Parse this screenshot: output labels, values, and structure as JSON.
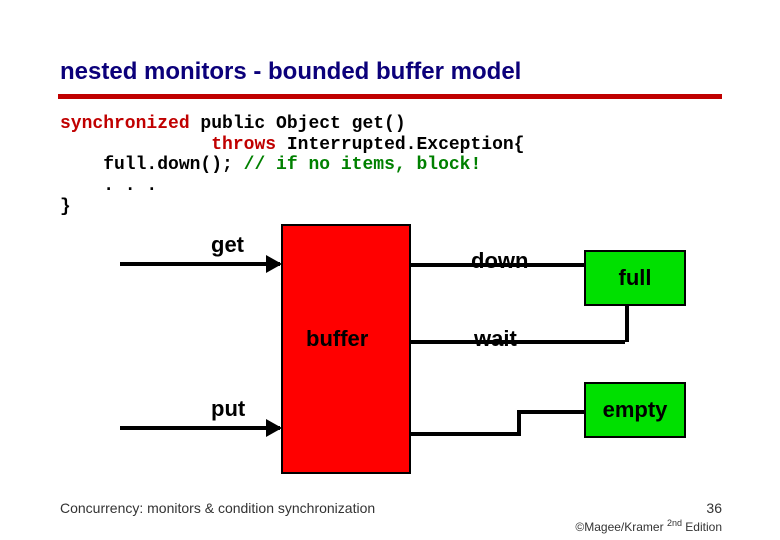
{
  "title": "nested monitors -  bounded buffer model",
  "code": {
    "kw_synchronized": "synchronized",
    "sig_part1": " public Object get()",
    "kw_throws": "throws",
    "sig_part2": " Interrupted.Exception{",
    "line3_a": "    full.down(); ",
    "cm_block": "// if no items, block!",
    "line4": "    . . .",
    "line5": "}"
  },
  "diagram": {
    "buffer": "buffer",
    "get": "get",
    "put": "put",
    "down": "down",
    "wait": "wait",
    "full": "full",
    "empty": "empty"
  },
  "footer": {
    "left": "Concurrency: monitors & condition synchronization",
    "page": "36",
    "credit_prefix": "©Magee/Kramer ",
    "credit_edition_sup": "2nd",
    "credit_suffix": " Edition"
  }
}
